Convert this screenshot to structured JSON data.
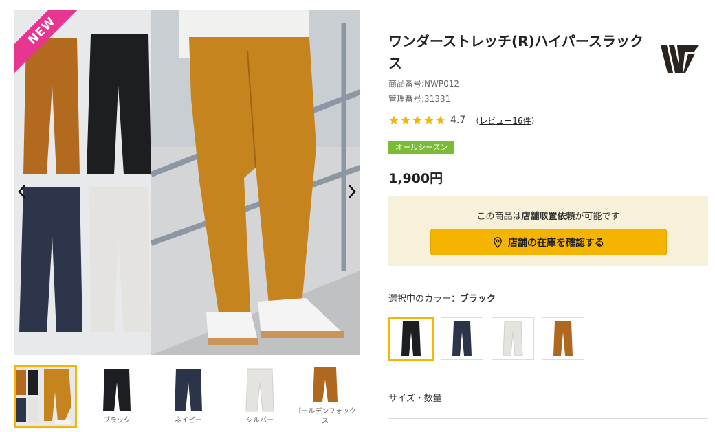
{
  "gallery": {
    "badge": "NEW",
    "thumbnails": [
      {
        "label": "",
        "color": "collage"
      },
      {
        "label": "ブラック",
        "color": "#1c1e22"
      },
      {
        "label": "ネイビー",
        "color": "#2b3448"
      },
      {
        "label": "シルバー",
        "color": "#e4e3df"
      },
      {
        "label": "ゴールデンフォックス",
        "color": "#b0681f"
      }
    ]
  },
  "product": {
    "title": "ワンダーストレッチ(R)ハイパースラックス",
    "product_code": "商品番号:NWP012",
    "management_code": "管理番号:31331",
    "rating": 4.7,
    "rating_text": "4.7",
    "review_prefix": "（",
    "review_link": "レビュー16件",
    "review_suffix": "）",
    "season": "オールシーズン",
    "price": "1,900円"
  },
  "store_box": {
    "text_before": "この商品は",
    "text_bold": "店舗取置依頼",
    "text_after": "が可能です",
    "button_label": "店舗の在庫を確認する"
  },
  "color": {
    "label": "選択中のカラー：",
    "selected": "ブラック",
    "swatches": [
      {
        "color": "#1c1e22"
      },
      {
        "color": "#2b3448"
      },
      {
        "color": "#e4e3df"
      },
      {
        "color": "#b0681f"
      }
    ]
  },
  "size": {
    "label": "サイズ・数量"
  },
  "colors": {
    "accent": "#f2b705",
    "badge_pink": "#e8358f",
    "season_green": "#7bbc36",
    "store_bg": "#f8f1d9",
    "button_yellow": "#f5b400"
  }
}
